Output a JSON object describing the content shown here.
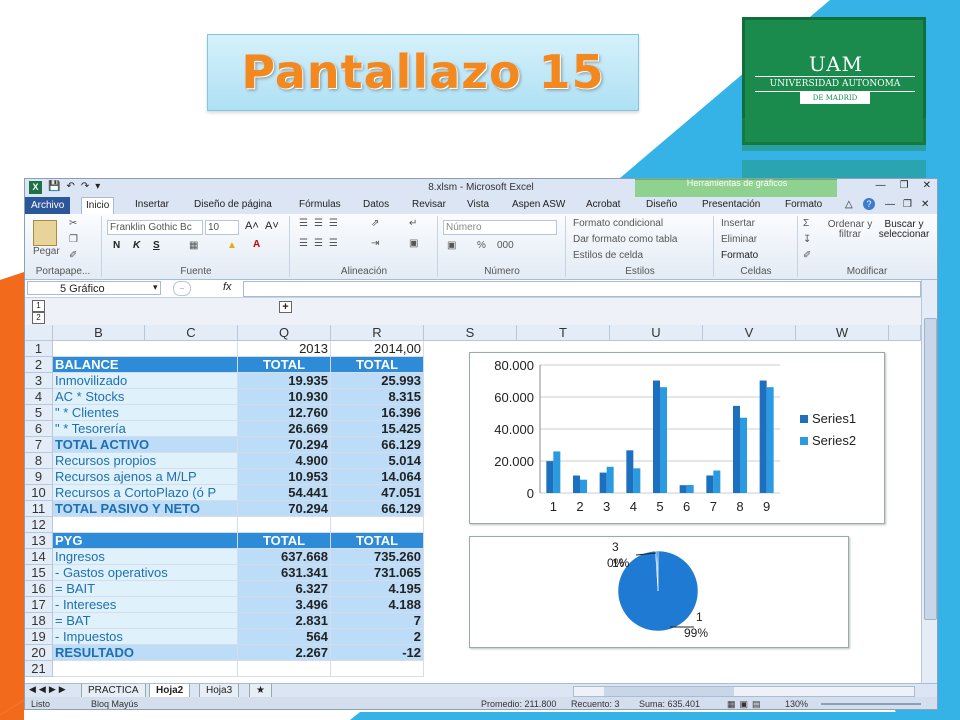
{
  "slide": {
    "title": "Pantallazo 15",
    "logo": {
      "mark": "UAM",
      "name": "UNIVERSIDAD AUTONOMA",
      "city": "DE MADRID"
    }
  },
  "excel": {
    "window_title": "8.xlsm - Microsoft Excel",
    "context_tools": "Herramientas de gráficos",
    "tabs": [
      "Archivo",
      "Inicio",
      "Insertar",
      "Diseño de página",
      "Fórmulas",
      "Datos",
      "Revisar",
      "Vista",
      "Aspen ASW",
      "Acrobat",
      "Diseño",
      "Presentación",
      "Formato"
    ],
    "ribbon": {
      "clipboard": {
        "label": "Portapape...",
        "paste": "Pegar"
      },
      "font": {
        "label": "Fuente",
        "name": "Franklin Gothic Bc",
        "size": "10",
        "bold": "N",
        "italic": "K",
        "underline": "S"
      },
      "alignment": {
        "label": "Alineación"
      },
      "number": {
        "label": "Número",
        "format": "Número",
        "percent": "%",
        "thousands": "000"
      },
      "styles": {
        "label": "Estilos",
        "conditional": "Formato condicional",
        "as_table": "Dar formato como tabla",
        "cell_styles": "Estilos de celda"
      },
      "cells": {
        "label": "Celdas",
        "insert": "Insertar",
        "delete": "Eliminar",
        "format": "Formato"
      },
      "editing": {
        "label": "Modificar",
        "sort": "Ordenar y filtrar",
        "find": "Buscar y seleccionar"
      }
    },
    "name_box": "5 Gráfico",
    "fx": "fx",
    "outline_levels": [
      "1",
      "2"
    ],
    "columns": [
      "B",
      "C",
      "Q",
      "R",
      "S",
      "T",
      "U",
      "V",
      "W"
    ],
    "rows": [
      {
        "n": "1",
        "label": "",
        "q": "2013",
        "r": "2014,00",
        "style": "year"
      },
      {
        "n": "2",
        "label": "BALANCE",
        "q": "TOTAL",
        "r": "TOTAL",
        "style": "hdr"
      },
      {
        "n": "3",
        "label": "Inmovilizado",
        "q": "19.935",
        "r": "25.993",
        "style": "data"
      },
      {
        "n": "4",
        "label": "AC * Stocks",
        "q": "10.930",
        "r": "8.315",
        "style": "data"
      },
      {
        "n": "5",
        "label": "  \"    * Clientes",
        "q": "12.760",
        "r": "16.396",
        "style": "data"
      },
      {
        "n": "6",
        "label": "  \"    * Tesorería",
        "q": "26.669",
        "r": "15.425",
        "style": "data"
      },
      {
        "n": "7",
        "label": "TOTAL ACTIVO",
        "q": "70.294",
        "r": "66.129",
        "style": "tot"
      },
      {
        "n": "8",
        "label": "Recursos propios",
        "q": "4.900",
        "r": "5.014",
        "style": "data"
      },
      {
        "n": "9",
        "label": "Recursos ajenos a M/LP",
        "q": "10.953",
        "r": "14.064",
        "style": "data"
      },
      {
        "n": "10",
        "label": "Recursos a CortoPlazo (ó P",
        "q": "54.441",
        "r": "47.051",
        "style": "data"
      },
      {
        "n": "11",
        "label": "TOTAL PASIVO Y NETO",
        "q": "70.294",
        "r": "66.129",
        "style": "tot"
      },
      {
        "n": "12",
        "label": "",
        "q": "",
        "r": "",
        "style": "blank"
      },
      {
        "n": "13",
        "label": "PYG",
        "q": "TOTAL",
        "r": "TOTAL",
        "style": "hdr"
      },
      {
        "n": "14",
        "label": "Ingresos",
        "q": "637.668",
        "r": "735.260",
        "style": "data"
      },
      {
        "n": "15",
        "label": "- Gastos operativos",
        "q": "631.341",
        "r": "731.065",
        "style": "data"
      },
      {
        "n": "16",
        "label": "= BAIT",
        "q": "6.327",
        "r": "4.195",
        "style": "data"
      },
      {
        "n": "17",
        "label": "- Intereses",
        "q": "3.496",
        "r": "4.188",
        "style": "data"
      },
      {
        "n": "18",
        "label": "= BAT",
        "q": "2.831",
        "r": "7",
        "style": "data"
      },
      {
        "n": "19",
        "label": "- Impuestos",
        "q": "564",
        "r": "2",
        "style": "data"
      },
      {
        "n": "20",
        "label": "RESULTADO",
        "q": "2.267",
        "r": "-12",
        "style": "tot"
      },
      {
        "n": "21",
        "label": "",
        "q": "",
        "r": "",
        "style": "blank"
      }
    ],
    "sheet_tabs": [
      "PRACTICA",
      "Hoja2",
      "Hoja3"
    ],
    "active_sheet": "Hoja2",
    "status": {
      "ready": "Listo",
      "caps": "Bloq Mayús",
      "average": "Promedio: 211.800",
      "count": "Recuento: 3",
      "sum": "Suma: 635.401",
      "zoom": "130%"
    }
  },
  "chart_data": [
    {
      "type": "bar",
      "categories": [
        "1",
        "2",
        "3",
        "4",
        "5",
        "6",
        "7",
        "8",
        "9"
      ],
      "series": [
        {
          "name": "Series1",
          "values": [
            19935,
            10930,
            12760,
            26669,
            70294,
            4900,
            10953,
            54441,
            70294
          ],
          "color": "#1f6fbf"
        },
        {
          "name": "Series2",
          "values": [
            25993,
            8315,
            16396,
            15425,
            66129,
            5014,
            14064,
            47051,
            66129
          ],
          "color": "#2a9be0"
        }
      ],
      "yticks": [
        "80.000",
        "60.000",
        "40.000",
        "20.000",
        "0"
      ],
      "ylim": [
        0,
        80000
      ],
      "legend": "right"
    },
    {
      "type": "pie",
      "slices": [
        {
          "label": "1",
          "pct_label": "99%",
          "value": 99
        },
        {
          "label": "2",
          "pct_label": "0%",
          "value": 0.5
        },
        {
          "label": "3",
          "pct_label": "1%",
          "value": 0.5
        }
      ],
      "color": "#1f7ad4"
    }
  ]
}
